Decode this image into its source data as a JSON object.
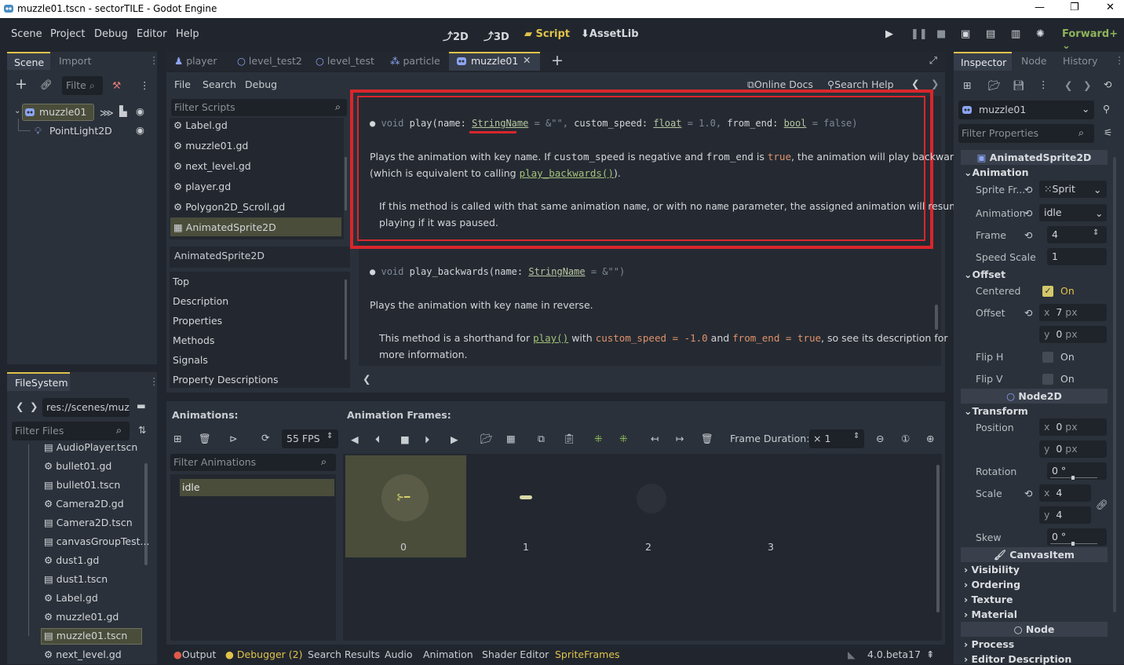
{
  "window": {
    "title": "muzzle01.tscn - sectorTILE - Godot Engine"
  },
  "menu": [
    "Scene",
    "Project",
    "Debug",
    "Editor",
    "Help"
  ],
  "workspaces": {
    "w2d": "2D",
    "w3d": "3D",
    "script": "Script",
    "assetlib": "AssetLib"
  },
  "renderer": "Forward+",
  "scene_dock": {
    "tabs": [
      "Scene",
      "Import"
    ],
    "filter_placeholder": "Filte",
    "tree": [
      {
        "name": "muzzle01"
      },
      {
        "name": "PointLight2D"
      }
    ]
  },
  "filesystem": {
    "tab": "FileSystem",
    "path": "res://scenes/muzz",
    "filter_placeholder": "Filter Files",
    "files": [
      "AudioPlayer.tscn",
      "bullet01.gd",
      "bullet01.tscn",
      "Camera2D.gd",
      "Camera2D.tscn",
      "canvasGroupTest...",
      "dust1.gd",
      "dust1.tscn",
      "Label.gd",
      "muzzle01.gd",
      "muzzle01.tscn",
      "next_level.gd"
    ]
  },
  "editor_tabs": [
    "player",
    "level_test2",
    "level_test",
    "particle",
    "muzzle01"
  ],
  "script_menu": [
    "File",
    "Search",
    "Debug"
  ],
  "script_links": {
    "online_docs": "Online Docs",
    "search_help": "Search Help"
  },
  "script_list": {
    "filter_placeholder": "Filter Scripts",
    "items": [
      "Label.gd",
      "muzzle01.gd",
      "next_level.gd",
      "player.gd",
      "Polygon2D_Scroll.gd",
      "AnimatedSprite2D"
    ],
    "current": "AnimatedSprite2D",
    "outline": [
      "Top",
      "Description",
      "Properties",
      "Methods",
      "Signals",
      "Property Descriptions"
    ]
  },
  "docs": {
    "m1": {
      "ret": "void",
      "name": "play",
      "p1": "name:",
      "t1": "StringName",
      "eq": "= &\"\",",
      "p2": "custom_speed:",
      "t2": "float",
      "v2": "= 1.0,",
      "p3": "from_end:",
      "t3": "bool",
      "v3": "= false)"
    },
    "d1a": "Plays the animation with key ",
    "d1b": "name",
    "d1c": ". If ",
    "d1d": "custom_speed",
    "d1e": " is negative and ",
    "d1f": "from_end",
    "d1g": " is ",
    "d1h": "true",
    "d1i": ", the animation will play backwards",
    "d1j": "(which is equivalent to calling ",
    "d1k": "play_backwards()",
    "d1l": ").",
    "d2a": "If this method is called with that same animation ",
    "d2b": "name",
    "d2c": ", or with no ",
    "d2d": "name",
    "d2e": " parameter, the assigned animation will resume",
    "d2f": "playing if it was paused.",
    "m2": {
      "ret": "void",
      "name": "play_backwards",
      "p1": "(name:",
      "t1": "StringName",
      "v1": "= &\"\")"
    },
    "d3a": "Plays the animation with key ",
    "d3b": "name",
    "d3c": " in reverse.",
    "d4a": "This method is a shorthand for ",
    "d4b": "play()",
    "d4c": " with ",
    "d4d": "custom_speed = -1.0",
    "d4e": " and ",
    "d4f": "from_end = true",
    "d4g": ", so see its description for",
    "d4h": "more information."
  },
  "animations": {
    "label": "Animations:",
    "fps": "55 FPS",
    "filter_placeholder": "Filter Animations",
    "items": [
      "idle"
    ],
    "frames_label": "Animation Frames:",
    "frame_duration_label": "Frame Duration:",
    "frame_duration_value": "× 1",
    "frames": [
      "0",
      "1",
      "2",
      "3"
    ]
  },
  "bottom_tabs": [
    "Output",
    "Debugger (2)",
    "Search Results",
    "Audio",
    "Animation",
    "Shader Editor",
    "SpriteFrames"
  ],
  "version": "4.0.beta17",
  "inspector": {
    "tabs": [
      "Inspector",
      "Node",
      "History"
    ],
    "node": "muzzle01",
    "filter_placeholder": "Filter Properties",
    "class": "AnimatedSprite2D",
    "sec_animation": "Animation",
    "sprite_frames": {
      "label": "Sprite Fr...",
      "value": "Sprit"
    },
    "animation": {
      "label": "Animation",
      "value": "idle"
    },
    "frame": {
      "label": "Frame",
      "value": "4"
    },
    "speed_scale": {
      "label": "Speed Scale",
      "value": "1"
    },
    "sec_offset": "Offset",
    "centered": {
      "label": "Centered",
      "value": "On"
    },
    "offset": {
      "label": "Offset",
      "x": "7",
      "y": "0",
      "unit": "px"
    },
    "flip_h": {
      "label": "Flip H",
      "value": "On"
    },
    "flip_v": {
      "label": "Flip V",
      "value": "On"
    },
    "node2d": "Node2D",
    "sec_transform": "Transform",
    "position": {
      "label": "Position",
      "x": "0",
      "y": "0",
      "unit": "px"
    },
    "rotation": {
      "label": "Rotation",
      "value": "0 °"
    },
    "scale": {
      "label": "Scale",
      "x": "4",
      "y": "4"
    },
    "skew": {
      "label": "Skew",
      "value": "0 °"
    },
    "canvasitem": "CanvasItem",
    "groups": [
      "Visibility",
      "Ordering",
      "Texture",
      "Material"
    ],
    "node_section": "Node",
    "groups2": [
      "Process",
      "Editor Description"
    ],
    "axis_x": "x",
    "axis_y": "y"
  },
  "colors": {
    "accent": "#e0c34a",
    "highlight_box": "#d9262c",
    "selected": "#4a4d3a"
  }
}
